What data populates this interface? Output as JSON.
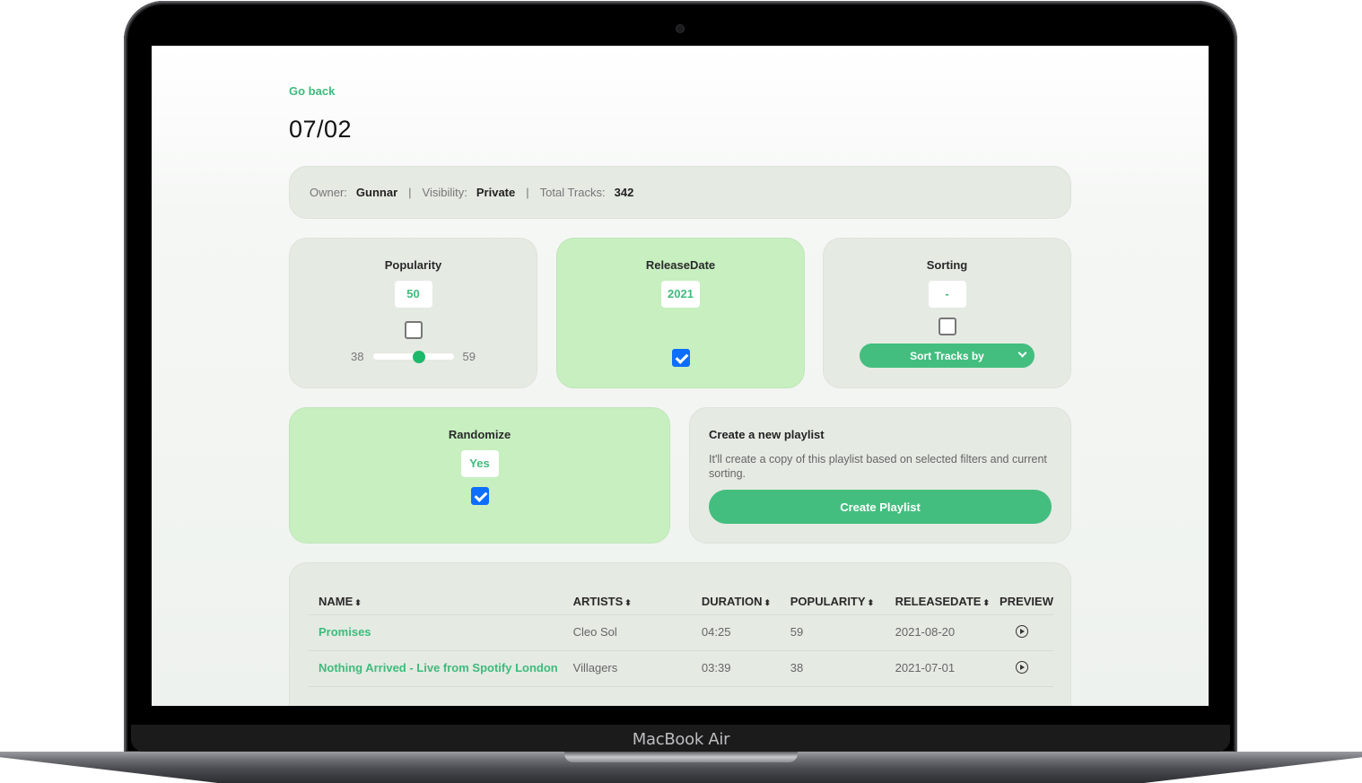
{
  "device": {
    "label": "MacBook Air"
  },
  "nav": {
    "go_back": "Go back"
  },
  "page": {
    "title": "07/02"
  },
  "info": {
    "owner_label": "Owner:",
    "owner": "Gunnar",
    "visibility_label": "Visibility:",
    "visibility": "Private",
    "total_tracks_label": "Total Tracks:",
    "total_tracks": "342",
    "separator": "|"
  },
  "filters": {
    "popularity": {
      "title": "Popularity",
      "value": "50",
      "checked": false,
      "range_min": "38",
      "range_max": "59",
      "slider_value": 50
    },
    "release_date": {
      "title": "ReleaseDate",
      "value": "2021",
      "checked": true
    },
    "sorting": {
      "title": "Sorting",
      "value": "-",
      "checked": false,
      "select_label": "Sort Tracks by"
    },
    "randomize": {
      "title": "Randomize",
      "value": "Yes",
      "checked": true
    }
  },
  "create_playlist": {
    "title": "Create a new playlist",
    "description": "It'll create a copy of this playlist based on selected filters and current sorting.",
    "button_label": "Create Playlist"
  },
  "colors": {
    "accent": "#43be7e",
    "active_card": "#c7efc0",
    "card": "#e5eae3",
    "checkbox": "#0d6efd"
  },
  "table": {
    "columns": [
      "NAME",
      "ARTISTS",
      "DURATION",
      "POPULARITY",
      "RELEASEDATE",
      "PREVIEW"
    ],
    "sort_indicator": "⬍",
    "rows": [
      {
        "name": "Promises",
        "artists": "Cleo Sol",
        "duration": "04:25",
        "popularity": "59",
        "release_date": "2021-08-20"
      },
      {
        "name": "Nothing Arrived - Live from Spotify London",
        "artists": "Villagers",
        "duration": "03:39",
        "popularity": "38",
        "release_date": "2021-07-01"
      }
    ]
  }
}
